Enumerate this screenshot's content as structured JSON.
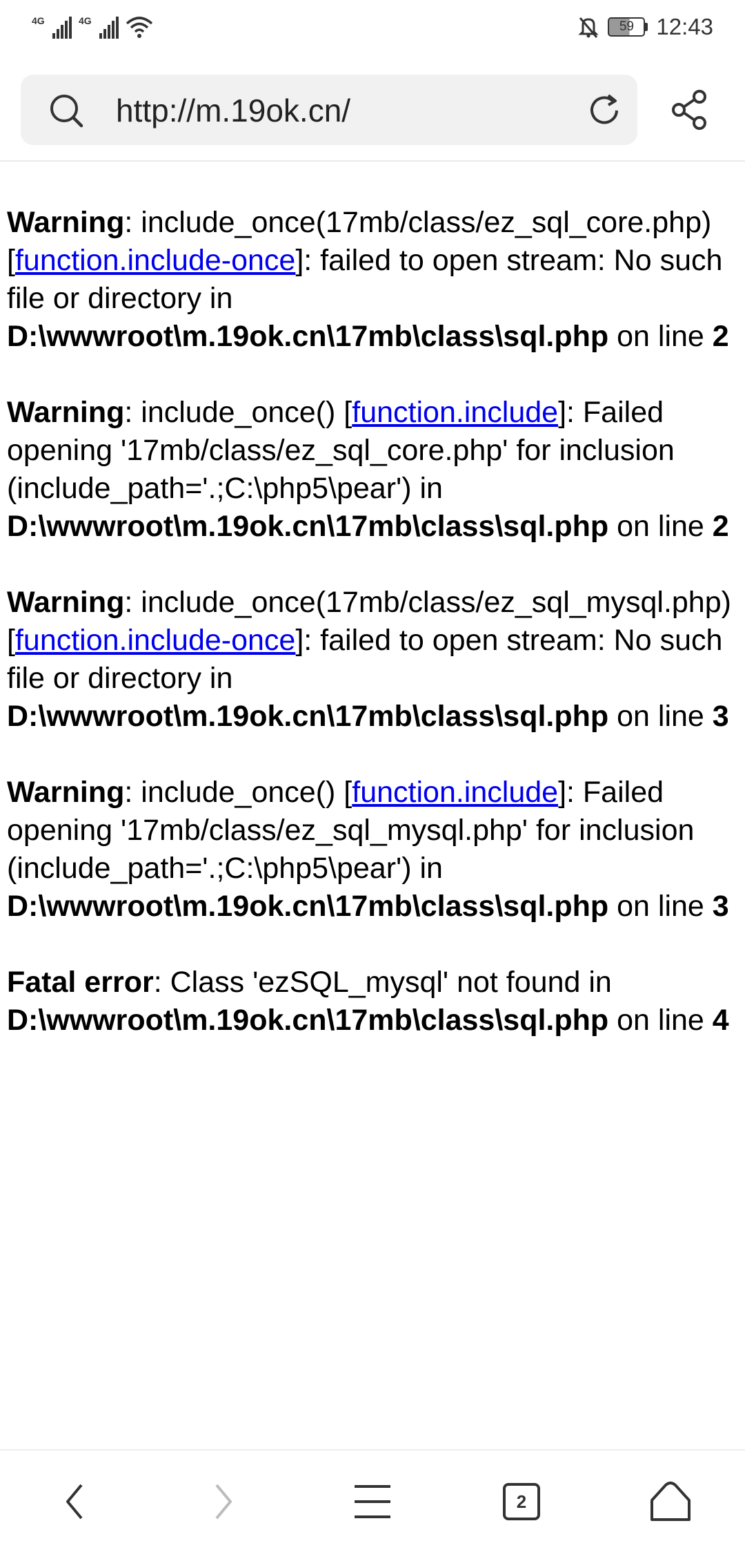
{
  "status_bar": {
    "signal1_tag": "4G",
    "signal2_tag": "4G",
    "battery_level": "59",
    "time": "12:43"
  },
  "address_bar": {
    "url": "http://m.19ok.cn/"
  },
  "messages": [
    {
      "label": "Warning",
      "pre": ": include_once(17mb/class/ez_sql_core.php) [",
      "link": "function.include-once",
      "post": "]: failed to open stream: No such file or directory in ",
      "path": "D:\\wwwroot\\m.19ok.cn\\17mb\\class\\sql.php",
      "on_line": " on line ",
      "line": "2"
    },
    {
      "label": "Warning",
      "pre": ": include_once() [",
      "link": "function.include",
      "post": "]: Failed opening '17mb/class/ez_sql_core.php' for inclusion (include_path='.;C:\\php5\\pear') in ",
      "path": "D:\\wwwroot\\m.19ok.cn\\17mb\\class\\sql.php",
      "on_line": " on line ",
      "line": "2"
    },
    {
      "label": "Warning",
      "pre": ": include_once(17mb/class/ez_sql_mysql.php) [",
      "link": "function.include-once",
      "post": "]: failed to open stream: No such file or directory in ",
      "path": "D:\\wwwroot\\m.19ok.cn\\17mb\\class\\sql.php",
      "on_line": " on line ",
      "line": "3"
    },
    {
      "label": "Warning",
      "pre": ": include_once() [",
      "link": "function.include",
      "post": "]: Failed opening '17mb/class/ez_sql_mysql.php' for inclusion (include_path='.;C:\\php5\\pear') in ",
      "path": "D:\\wwwroot\\m.19ok.cn\\17mb\\class\\sql.php",
      "on_line": " on line ",
      "line": "3"
    }
  ],
  "fatal": {
    "label": "Fatal error",
    "text": ": Class 'ezSQL_mysql' not found in ",
    "path": "D:\\wwwroot\\m.19ok.cn\\17mb\\class\\sql.php",
    "on_line": " on line ",
    "line": "4"
  },
  "bottom_nav": {
    "tab_count": "2",
    "icons": [
      "back-icon",
      "forward-icon",
      "menu-icon",
      "tabs-icon",
      "home-icon"
    ]
  }
}
